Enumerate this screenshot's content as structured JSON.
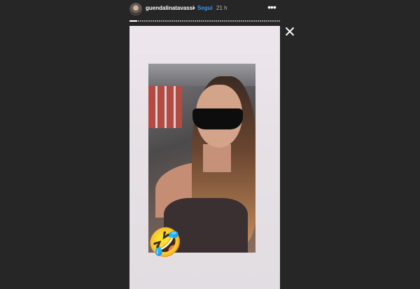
{
  "header": {
    "username": "guendalinatavassi",
    "separator": "•",
    "follow_label": "Segui",
    "time_ago": "21 h",
    "more_icon": "more-icon"
  },
  "progress": {
    "segments_total": 1,
    "current_fraction": 0.05
  },
  "story": {
    "sticker_icon": "rolling-on-floor-laughing-emoji",
    "sticker_glyph": "🤣"
  },
  "colors": {
    "background": "#262626",
    "follow": "#3897f0",
    "text": "#ffffff"
  }
}
